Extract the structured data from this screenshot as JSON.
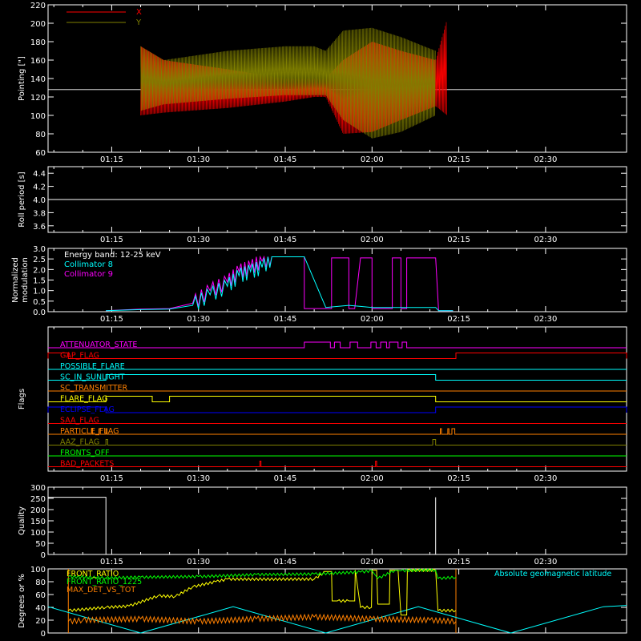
{
  "chart_data": [
    {
      "type": "line",
      "ylabel": "Pointing [\"]",
      "ylim": [
        60,
        220
      ],
      "yticks": [
        60,
        80,
        100,
        120,
        140,
        160,
        180,
        200,
        220
      ],
      "xlim_minutes": [
        64,
        164
      ],
      "xticks": [
        "01:15",
        "01:30",
        "01:45",
        "02:00",
        "02:15",
        "02:30"
      ],
      "reference_line": 128,
      "legend_position": "top-left",
      "series": [
        {
          "name": "X",
          "color": "#ff0000",
          "envelope": [
            [
              80,
              100,
              175
            ],
            [
              84,
              103,
              160
            ],
            [
              95,
              108,
              150
            ],
            [
              105,
              115,
              140
            ],
            [
              110,
              120,
              140
            ],
            [
              112,
              120,
              140
            ],
            [
              115,
              80,
              160
            ],
            [
              120,
              82,
              180
            ],
            [
              125,
              95,
              170
            ],
            [
              131,
              110,
              160
            ],
            [
              133,
              100,
              205
            ]
          ]
        },
        {
          "name": "Y",
          "color": "#808000",
          "envelope": [
            [
              80,
              105,
              175
            ],
            [
              84,
              112,
              160
            ],
            [
              95,
              118,
              170
            ],
            [
              105,
              122,
              175
            ],
            [
              110,
              122,
              175
            ],
            [
              112,
              122,
              170
            ],
            [
              115,
              95,
              192
            ],
            [
              120,
              75,
              195
            ],
            [
              125,
              82,
              185
            ],
            [
              131,
              100,
              170
            ]
          ]
        }
      ]
    },
    {
      "type": "line",
      "ylabel": "Roll period [s]",
      "ylim": [
        3.5,
        4.5
      ],
      "yticks": [
        "3.6",
        "3.8",
        "4.0",
        "4.2",
        "4.4"
      ],
      "xticks": [
        "01:15",
        "01:30",
        "01:45",
        "02:00",
        "02:15",
        "02:30"
      ],
      "series": [
        {
          "name": "",
          "color": "#ffffff",
          "x": [
            64,
            164
          ],
          "values": [
            4.0,
            4.0
          ]
        }
      ]
    },
    {
      "type": "line",
      "ylabel": [
        "Normalized",
        "modulation"
      ],
      "ylim": [
        0,
        3.0
      ],
      "yticks": [
        "0.0",
        "0.5",
        "1.0",
        "1.5",
        "2.0",
        "2.5",
        "3.0"
      ],
      "xticks": [
        "01:15",
        "01:30",
        "01:45",
        "02:00",
        "02:15",
        "02:30"
      ],
      "legend_title": "Energy band: 12-25 keV",
      "series": [
        {
          "name": "Collimator 8",
          "color": "#00ffff",
          "x": [
            74,
            80,
            85,
            89,
            92,
            95,
            97,
            99,
            101,
            103,
            105,
            107,
            108.3,
            112,
            116,
            118,
            120,
            123.5,
            125,
            131,
            131.5,
            134
          ],
          "values": [
            0.05,
            0.1,
            0.12,
            0.3,
            0.8,
            1.2,
            1.7,
            1.9,
            2.1,
            2.6,
            2.6,
            2.6,
            2.6,
            0.2,
            0.3,
            0.25,
            0.2,
            0.2,
            0.2,
            0.2,
            0.05,
            0.05
          ]
        },
        {
          "name": "Collimator 9",
          "color": "#ff00ff",
          "x": [
            74,
            80,
            85,
            89,
            92,
            95,
            97,
            99,
            101,
            103,
            105,
            107,
            108.3,
            108.3,
            112,
            113,
            113,
            116,
            116,
            117,
            118,
            120,
            120,
            122,
            123.5,
            123.5,
            125,
            125,
            126,
            126,
            131,
            131.5,
            134
          ],
          "values": [
            0.05,
            0.12,
            0.15,
            0.4,
            1.0,
            1.4,
            1.9,
            2.1,
            2.4,
            2.6,
            2.6,
            2.6,
            2.6,
            0.15,
            0.15,
            0.15,
            2.55,
            2.55,
            0.15,
            0.15,
            2.55,
            2.55,
            0.15,
            0.15,
            0.15,
            2.55,
            2.55,
            0.15,
            0.15,
            2.55,
            2.55,
            0.05,
            0.05
          ]
        }
      ]
    },
    {
      "type": "line",
      "ylabel": "Flags",
      "xticks": [
        "01:15",
        "01:30",
        "01:45",
        "02:00",
        "02:15",
        "02:30"
      ],
      "flags": [
        {
          "label": "ATTENUATOR_STATE",
          "color": "#ff00ff",
          "on": [
            [
              108.3,
              112.8
            ],
            [
              113.5,
              114.5
            ],
            [
              116.2,
              117.5
            ],
            [
              119.8,
              120.7
            ],
            [
              121.5,
              122.5
            ],
            [
              123,
              124.5
            ],
            [
              125.2,
              126
            ]
          ]
        },
        {
          "label": "GAP_FLAG",
          "color": "#ff0000",
          "on": [
            [
              64,
              67.5
            ],
            [
              134.5,
              164
            ]
          ]
        },
        {
          "label": "POSSIBLE_FLARE",
          "color": "#00ffff",
          "on": []
        },
        {
          "label": "SC_IN_SUNLIGHT",
          "color": "#00ffff",
          "on": [
            [
              74,
              131
            ]
          ]
        },
        {
          "label": "SC_TRANSMITTER",
          "color": "#ff8000",
          "on": []
        },
        {
          "label": "FLARE_FLAG",
          "color": "#ffff00",
          "on": [
            [
              74,
              82
            ],
            [
              85,
              131
            ]
          ]
        },
        {
          "label": "ECLIPSE_FLAG",
          "color": "#0000ff",
          "on": [
            [
              64,
              74
            ],
            [
              131,
              164
            ]
          ]
        },
        {
          "label": "SAA_FLAG",
          "color": "#ff0000",
          "on": []
        },
        {
          "label": "PARTICLE_FLAG",
          "color": "#ff8000",
          "on": [
            [
              71.5,
              71.7
            ],
            [
              72.8,
              73
            ],
            [
              74,
              74.2
            ],
            [
              131.8,
              132
            ],
            [
              133.1,
              133.3
            ],
            [
              133.8,
              134.3
            ]
          ]
        },
        {
          "label": "AAZ_FLAG",
          "color": "#808000",
          "on": [
            [
              74,
              74.3
            ],
            [
              130.5,
              131
            ]
          ]
        },
        {
          "label": "FRONTS_OFF",
          "color": "#00ff00",
          "on": []
        },
        {
          "label": "BAD_PACKETS",
          "color": "#ff0000",
          "on": [
            [
              100.6,
              100.8
            ],
            [
              120.6,
              120.8
            ]
          ]
        }
      ]
    },
    {
      "type": "line",
      "ylabel": "Quality",
      "ylim": [
        0,
        300
      ],
      "yticks": [
        "0",
        "50",
        "100",
        "150",
        "200",
        "250",
        "300"
      ],
      "xticks": [
        "01:15",
        "01:30",
        "01:45",
        "02:00",
        "02:15",
        "02:30"
      ],
      "series": [
        {
          "name": "",
          "color": "#ffffff",
          "x": [
            64,
            74,
            74,
            131,
            131
          ],
          "values": [
            255,
            255,
            0,
            0,
            255
          ]
        }
      ]
    },
    {
      "type": "line",
      "ylabel": "Degrees or %",
      "ylim": [
        0,
        100
      ],
      "yticks": [
        "0",
        "20",
        "40",
        "60",
        "80",
        "100"
      ],
      "xticks": [
        "01:15",
        "01:30",
        "01:45",
        "02:00",
        "02:15",
        "02:30"
      ],
      "annotation": "Absolute geomagnetic latitude",
      "series": [
        {
          "name": "FRONT_RATIO",
          "color": "#ffff00",
          "x": [
            67.5,
            74,
            78,
            83,
            86,
            89,
            93,
            95,
            110,
            112,
            113,
            113.1,
            114,
            116,
            117,
            117.1,
            118,
            119.9,
            120,
            120.8,
            121,
            122,
            123,
            123.1,
            124.5,
            125,
            125.5,
            126,
            126.1,
            131,
            131.4,
            134.5
          ],
          "values": [
            35,
            40,
            42,
            58,
            57,
            72,
            80,
            84,
            84,
            96,
            96,
            50,
            50,
            50,
            50,
            98,
            40,
            40,
            98,
            98,
            45,
            45,
            45,
            98,
            98,
            28,
            28,
            28,
            98,
            98,
            35,
            35
          ]
        },
        {
          "name": "FRONT_RATIO_1225",
          "color": "#00ff00",
          "x": [
            67.5,
            74,
            80,
            90,
            100,
            110,
            118,
            120,
            121,
            124,
            125,
            128,
            131,
            131.4,
            134.5
          ],
          "values": [
            88,
            86,
            87,
            88,
            91,
            92,
            95,
            97,
            85,
            98,
            97,
            98,
            98,
            85,
            87
          ]
        },
        {
          "name": "MAX_DET_VS_TOT",
          "color": "#ff8000",
          "x": [
            67.5,
            70,
            80,
            90,
            100,
            110,
            120,
            130,
            134.5
          ],
          "values": [
            18,
            20,
            22,
            18,
            22,
            25,
            22,
            20,
            18
          ]
        },
        {
          "name": "Absolute geomagnetic latitude",
          "color": "#00ffff",
          "x": [
            64,
            80,
            96,
            112,
            128,
            144,
            160,
            164
          ],
          "values": [
            41,
            0,
            41,
            0,
            41,
            0,
            41,
            43
          ]
        }
      ]
    }
  ]
}
